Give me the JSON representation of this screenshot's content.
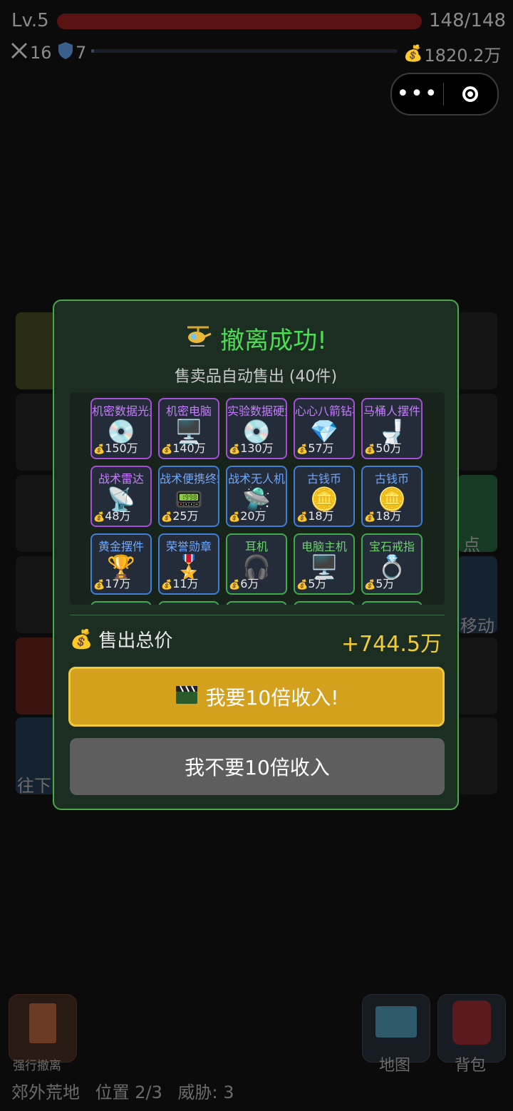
{
  "hud": {
    "level": "Lv.5",
    "hp": {
      "current": 148,
      "max": 148,
      "text": "148/148",
      "bar_color": "#5a1212"
    },
    "attack": "16",
    "defense": "7",
    "xp_fraction": 0.01,
    "gold": "1820.2万",
    "icons": [
      "swords-icon",
      "shield-icon",
      "money-bag-icon"
    ]
  },
  "capsule": {
    "more_icon": "more-dots-icon",
    "close_icon": "record-circle-icon"
  },
  "background": {
    "labels": [
      "点",
      "移动",
      "往下"
    ]
  },
  "bottom": {
    "force_evacuate": "强行撤离",
    "map": "地图",
    "backpack": "背包",
    "status": {
      "area": "郊外荒地",
      "position": "位置 2/3",
      "threat": "威胁: 3"
    }
  },
  "modal": {
    "title": "撤离成功!",
    "subtitle": "售卖品自动售出 (40件)",
    "total_label": "售出总价",
    "total_value": "+744.5万",
    "btn_10x": "我要10倍收入!",
    "btn_no": "我不要10倍收入",
    "colors": {
      "accent": "#4ddc55",
      "gold": "#f2cc35",
      "button": "#d4a11f",
      "purple": "#a64fd8",
      "blue": "#3f7fd6",
      "green": "#3faa4a"
    },
    "items": [
      {
        "name": "机密数据光盘",
        "icon": "💿",
        "price": "150万",
        "quality": "purple"
      },
      {
        "name": "机密电脑",
        "icon": "🖥️",
        "price": "140万",
        "quality": "purple"
      },
      {
        "name": "实验数据硬盘",
        "icon": "💿",
        "price": "130万",
        "quality": "purple"
      },
      {
        "name": "心心八箭钻石",
        "icon": "💎",
        "price": "57万",
        "quality": "purple"
      },
      {
        "name": "马桶人摆件",
        "icon": "🚽",
        "price": "50万",
        "quality": "purple"
      },
      {
        "name": "战术雷达",
        "icon": "📡",
        "price": "48万",
        "quality": "purple"
      },
      {
        "name": "战术便携终端",
        "icon": "📟",
        "price": "25万",
        "quality": "blue"
      },
      {
        "name": "战术无人机",
        "icon": "🛸",
        "price": "20万",
        "quality": "blue"
      },
      {
        "name": "古钱币",
        "icon": "🪙",
        "price": "18万",
        "quality": "blue"
      },
      {
        "name": "古钱币",
        "icon": "🪙",
        "price": "18万",
        "quality": "blue"
      },
      {
        "name": "黄金摆件",
        "icon": "🏆",
        "price": "17万",
        "quality": "blue"
      },
      {
        "name": "荣誉勋章",
        "icon": "🎖️",
        "price": "11万",
        "quality": "blue"
      },
      {
        "name": "耳机",
        "icon": "🎧",
        "price": "6万",
        "quality": "green"
      },
      {
        "name": "电脑主机",
        "icon": "🖥️",
        "price": "5万",
        "quality": "green"
      },
      {
        "name": "宝石戒指",
        "icon": "💍",
        "price": "5万",
        "quality": "green"
      }
    ]
  }
}
